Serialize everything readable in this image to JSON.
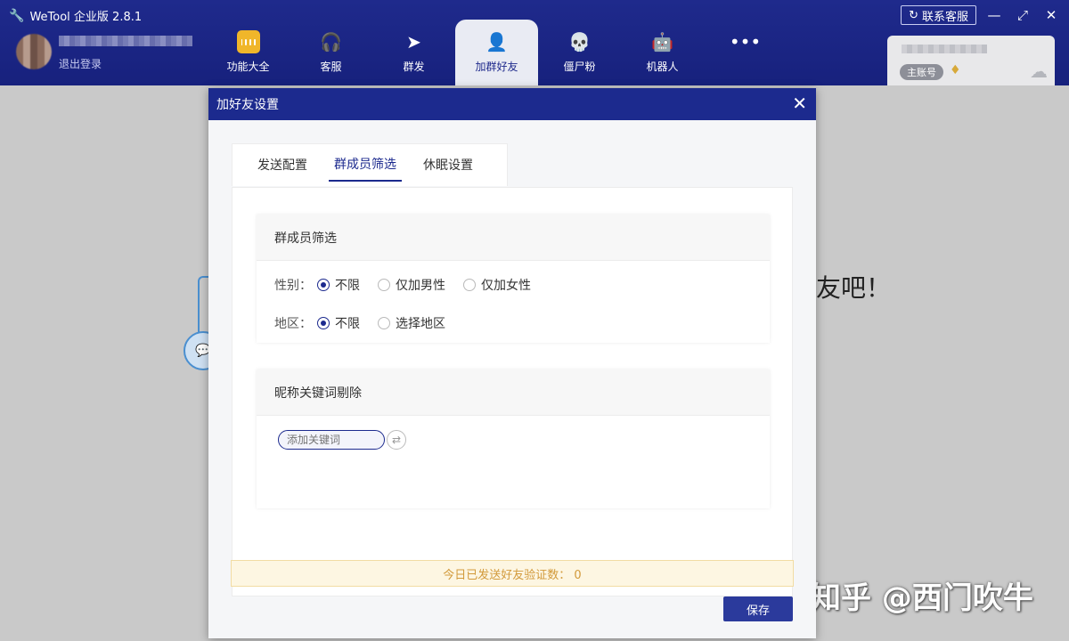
{
  "app": {
    "title": "WeTool 企业版 2.8.1"
  },
  "user": {
    "logout_label": "退出登录"
  },
  "nav": {
    "items": [
      {
        "label": "功能大全"
      },
      {
        "label": "客服"
      },
      {
        "label": "群发"
      },
      {
        "label": "加群好友"
      },
      {
        "label": "僵尸粉"
      },
      {
        "label": "机器人"
      },
      {
        "label": ""
      }
    ]
  },
  "window": {
    "support_label": "联系客服"
  },
  "account": {
    "badge": "主账号"
  },
  "background": {
    "hint_text": "友吧！",
    "watermark": "知乎 @西门吹牛"
  },
  "dialog": {
    "title": "加好友设置",
    "tabs": [
      {
        "label": "发送配置"
      },
      {
        "label": "群成员筛选"
      },
      {
        "label": "休眠设置"
      }
    ],
    "filter_card": {
      "title": "群成员筛选",
      "gender_label": "性别：",
      "gender_options": [
        "不限",
        "仅加男性",
        "仅加女性"
      ],
      "region_label": "地区：",
      "region_options": [
        "不限",
        "选择地区"
      ]
    },
    "keyword_card": {
      "title": "昵称关键词剔除",
      "input_placeholder": "添加关键词"
    },
    "notice": "今日已发送好友验证数： 0",
    "save_label": "保存"
  }
}
